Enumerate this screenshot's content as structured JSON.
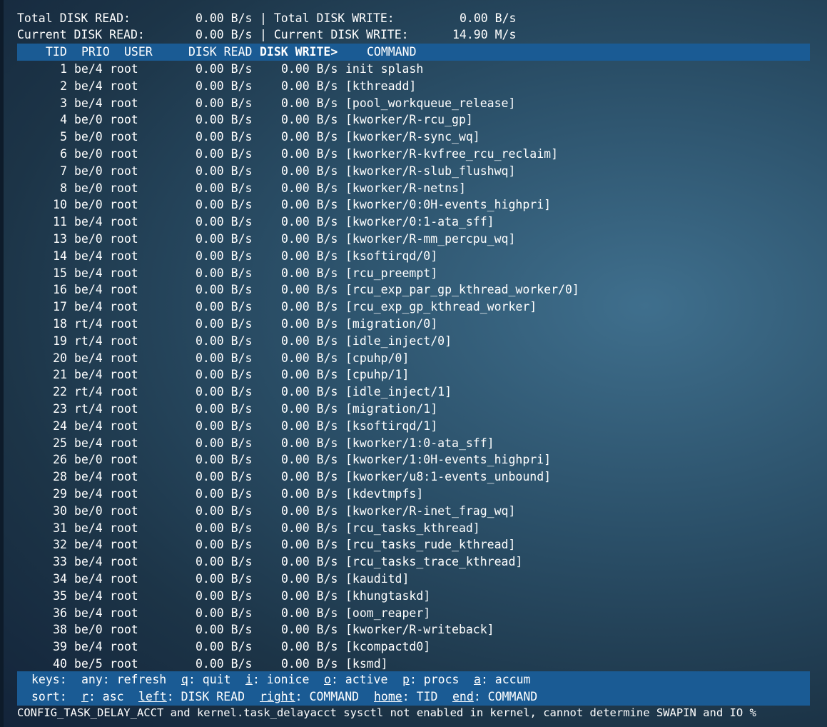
{
  "summary": {
    "total_read_label": "Total DISK READ:",
    "total_read_value": "0.00 B/s",
    "total_write_label": "| Total DISK WRITE:",
    "total_write_value": "0.00 B/s",
    "current_read_label": "Current DISK READ:",
    "current_read_value": "0.00 B/s",
    "current_write_label": "| Current DISK WRITE:",
    "current_write_value": "14.90 M/s"
  },
  "columns": {
    "tid": "TID",
    "prio": "PRIO",
    "user": "USER",
    "disk_read": "DISK READ",
    "disk_write": "DISK WRITE>",
    "command": "COMMAND"
  },
  "rows": [
    {
      "tid": "1",
      "prio": "be/4",
      "user": "root",
      "read": "0.00 B/s",
      "write": "0.00 B/s",
      "command": "init splash"
    },
    {
      "tid": "2",
      "prio": "be/4",
      "user": "root",
      "read": "0.00 B/s",
      "write": "0.00 B/s",
      "command": "[kthreadd]"
    },
    {
      "tid": "3",
      "prio": "be/4",
      "user": "root",
      "read": "0.00 B/s",
      "write": "0.00 B/s",
      "command": "[pool_workqueue_release]"
    },
    {
      "tid": "4",
      "prio": "be/0",
      "user": "root",
      "read": "0.00 B/s",
      "write": "0.00 B/s",
      "command": "[kworker/R-rcu_gp]"
    },
    {
      "tid": "5",
      "prio": "be/0",
      "user": "root",
      "read": "0.00 B/s",
      "write": "0.00 B/s",
      "command": "[kworker/R-sync_wq]"
    },
    {
      "tid": "6",
      "prio": "be/0",
      "user": "root",
      "read": "0.00 B/s",
      "write": "0.00 B/s",
      "command": "[kworker/R-kvfree_rcu_reclaim]"
    },
    {
      "tid": "7",
      "prio": "be/0",
      "user": "root",
      "read": "0.00 B/s",
      "write": "0.00 B/s",
      "command": "[kworker/R-slub_flushwq]"
    },
    {
      "tid": "8",
      "prio": "be/0",
      "user": "root",
      "read": "0.00 B/s",
      "write": "0.00 B/s",
      "command": "[kworker/R-netns]"
    },
    {
      "tid": "10",
      "prio": "be/0",
      "user": "root",
      "read": "0.00 B/s",
      "write": "0.00 B/s",
      "command": "[kworker/0:0H-events_highpri]"
    },
    {
      "tid": "11",
      "prio": "be/4",
      "user": "root",
      "read": "0.00 B/s",
      "write": "0.00 B/s",
      "command": "[kworker/0:1-ata_sff]"
    },
    {
      "tid": "13",
      "prio": "be/0",
      "user": "root",
      "read": "0.00 B/s",
      "write": "0.00 B/s",
      "command": "[kworker/R-mm_percpu_wq]"
    },
    {
      "tid": "14",
      "prio": "be/4",
      "user": "root",
      "read": "0.00 B/s",
      "write": "0.00 B/s",
      "command": "[ksoftirqd/0]"
    },
    {
      "tid": "15",
      "prio": "be/4",
      "user": "root",
      "read": "0.00 B/s",
      "write": "0.00 B/s",
      "command": "[rcu_preempt]"
    },
    {
      "tid": "16",
      "prio": "be/4",
      "user": "root",
      "read": "0.00 B/s",
      "write": "0.00 B/s",
      "command": "[rcu_exp_par_gp_kthread_worker/0]"
    },
    {
      "tid": "17",
      "prio": "be/4",
      "user": "root",
      "read": "0.00 B/s",
      "write": "0.00 B/s",
      "command": "[rcu_exp_gp_kthread_worker]"
    },
    {
      "tid": "18",
      "prio": "rt/4",
      "user": "root",
      "read": "0.00 B/s",
      "write": "0.00 B/s",
      "command": "[migration/0]"
    },
    {
      "tid": "19",
      "prio": "rt/4",
      "user": "root",
      "read": "0.00 B/s",
      "write": "0.00 B/s",
      "command": "[idle_inject/0]"
    },
    {
      "tid": "20",
      "prio": "be/4",
      "user": "root",
      "read": "0.00 B/s",
      "write": "0.00 B/s",
      "command": "[cpuhp/0]"
    },
    {
      "tid": "21",
      "prio": "be/4",
      "user": "root",
      "read": "0.00 B/s",
      "write": "0.00 B/s",
      "command": "[cpuhp/1]"
    },
    {
      "tid": "22",
      "prio": "rt/4",
      "user": "root",
      "read": "0.00 B/s",
      "write": "0.00 B/s",
      "command": "[idle_inject/1]"
    },
    {
      "tid": "23",
      "prio": "rt/4",
      "user": "root",
      "read": "0.00 B/s",
      "write": "0.00 B/s",
      "command": "[migration/1]"
    },
    {
      "tid": "24",
      "prio": "be/4",
      "user": "root",
      "read": "0.00 B/s",
      "write": "0.00 B/s",
      "command": "[ksoftirqd/1]"
    },
    {
      "tid": "25",
      "prio": "be/4",
      "user": "root",
      "read": "0.00 B/s",
      "write": "0.00 B/s",
      "command": "[kworker/1:0-ata_sff]"
    },
    {
      "tid": "26",
      "prio": "be/0",
      "user": "root",
      "read": "0.00 B/s",
      "write": "0.00 B/s",
      "command": "[kworker/1:0H-events_highpri]"
    },
    {
      "tid": "28",
      "prio": "be/4",
      "user": "root",
      "read": "0.00 B/s",
      "write": "0.00 B/s",
      "command": "[kworker/u8:1-events_unbound]"
    },
    {
      "tid": "29",
      "prio": "be/4",
      "user": "root",
      "read": "0.00 B/s",
      "write": "0.00 B/s",
      "command": "[kdevtmpfs]"
    },
    {
      "tid": "30",
      "prio": "be/0",
      "user": "root",
      "read": "0.00 B/s",
      "write": "0.00 B/s",
      "command": "[kworker/R-inet_frag_wq]"
    },
    {
      "tid": "31",
      "prio": "be/4",
      "user": "root",
      "read": "0.00 B/s",
      "write": "0.00 B/s",
      "command": "[rcu_tasks_kthread]"
    },
    {
      "tid": "32",
      "prio": "be/4",
      "user": "root",
      "read": "0.00 B/s",
      "write": "0.00 B/s",
      "command": "[rcu_tasks_rude_kthread]"
    },
    {
      "tid": "33",
      "prio": "be/4",
      "user": "root",
      "read": "0.00 B/s",
      "write": "0.00 B/s",
      "command": "[rcu_tasks_trace_kthread]"
    },
    {
      "tid": "34",
      "prio": "be/4",
      "user": "root",
      "read": "0.00 B/s",
      "write": "0.00 B/s",
      "command": "[kauditd]"
    },
    {
      "tid": "35",
      "prio": "be/4",
      "user": "root",
      "read": "0.00 B/s",
      "write": "0.00 B/s",
      "command": "[khungtaskd]"
    },
    {
      "tid": "36",
      "prio": "be/4",
      "user": "root",
      "read": "0.00 B/s",
      "write": "0.00 B/s",
      "command": "[oom_reaper]"
    },
    {
      "tid": "38",
      "prio": "be/0",
      "user": "root",
      "read": "0.00 B/s",
      "write": "0.00 B/s",
      "command": "[kworker/R-writeback]"
    },
    {
      "tid": "39",
      "prio": "be/4",
      "user": "root",
      "read": "0.00 B/s",
      "write": "0.00 B/s",
      "command": "[kcompactd0]"
    },
    {
      "tid": "40",
      "prio": "be/5",
      "user": "root",
      "read": "0.00 B/s",
      "write": "0.00 B/s",
      "command": "[ksmd]"
    }
  ],
  "keys": {
    "label": "keys:",
    "any": "any: refresh",
    "q_key": "q",
    "q_label": ": quit",
    "i_key": "i",
    "i_label": ": ionice",
    "o_key": "o",
    "o_label": ": active",
    "p_key": "p",
    "p_label": ": procs",
    "a_key": "a",
    "a_label": ": accum"
  },
  "sort": {
    "label": "sort:",
    "r_key": "r",
    "r_label": ": asc",
    "left_key": "left",
    "left_label": ": DISK READ",
    "right_key": "right",
    "right_label": ": COMMAND",
    "home_key": "home",
    "home_label": ": TID",
    "end_key": "end",
    "end_label": ": COMMAND"
  },
  "status_message": "CONFIG_TASK_DELAY_ACCT and kernel.task_delayacct sysctl not enabled in kernel, cannot determine SWAPIN and IO %",
  "colors": {
    "header_bar": "#1a5b94",
    "text": "#ffffff"
  }
}
